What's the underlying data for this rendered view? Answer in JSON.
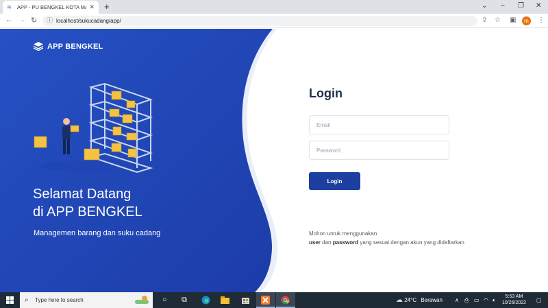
{
  "browser": {
    "tab_title": "APP - PU BENGKEL KOTA MAKASSAR",
    "url": "localhost/sukucadang/app/",
    "profile_initial": "m"
  },
  "brand": {
    "name": "APP BENGKEL"
  },
  "hero": {
    "line1": "Selamat Datang",
    "line2": "di APP BENGKEL",
    "tagline": "Managemen barang dan suku cadang"
  },
  "login": {
    "title": "Login",
    "email_placeholder": "Email",
    "password_placeholder": "Password",
    "button_label": "Login",
    "note_line1": "Mohon untuk menggunakan",
    "note_user": "user",
    "note_and": "dan",
    "note_password": "password",
    "note_rest": "yang sesuai dengan akun yang didaftarkan"
  },
  "taskbar": {
    "search_placeholder": "Type here to search",
    "weather_temp": "24°C",
    "weather_desc": "Berawan",
    "time": "5:53 AM",
    "date": "10/26/2022"
  },
  "colors": {
    "brand_blue": "#2346b8",
    "button_blue": "#1c3fa0",
    "heading": "#1f2d4f"
  }
}
